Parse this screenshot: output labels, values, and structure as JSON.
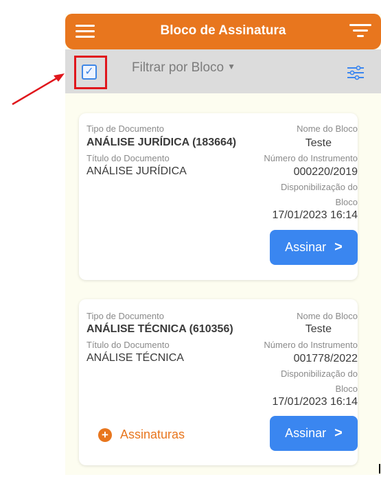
{
  "header": {
    "title": "Bloco de Assinatura"
  },
  "toolbar": {
    "filter_label": "Filtrar por Bloco",
    "checkbox_mark": "✓"
  },
  "labels": {
    "tipo_documento": "Tipo de Documento",
    "titulo_documento": "Título do Documento",
    "nome_bloco": "Nome do Bloco",
    "numero_instrumento": "Número do Instrumento",
    "disponibilizacao_line1": "Disponibilização do",
    "disponibilizacao_line2": "Bloco",
    "assinar": "Assinar",
    "assinaturas": "Assinaturas"
  },
  "cards": [
    {
      "tipo": "ANÁLISE JURÍDICA (183664)",
      "titulo": "ANÁLISE JURÍDICA",
      "nome_bloco": "Teste",
      "numero": "000220/2019",
      "data": "17/01/2023 16:14"
    },
    {
      "tipo": "ANÁLISE TÉCNICA (610356)",
      "titulo": "ANÁLISE TÉCNICA",
      "nome_bloco": "Teste",
      "numero": "001778/2022",
      "data": "17/01/2023 16:14"
    }
  ],
  "colors": {
    "header": "#e8761e",
    "primary_button": "#3a86f0",
    "annotation": "#e0161c"
  }
}
